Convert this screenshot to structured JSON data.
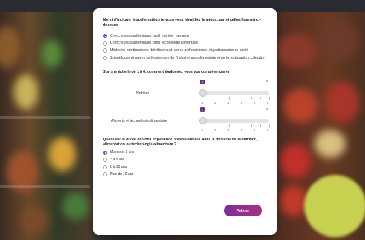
{
  "section1": {
    "question": "Merci d'indiquer à quelle catégorie vous vous identifiez le mieux, parmi celles figurant ci-dessous",
    "options": [
      {
        "label": "Chercheurs académiques, profil nutrition humaine",
        "selected": true
      },
      {
        "label": "Chercheurs académiques, profil technologie alimentaire",
        "selected": false
      },
      {
        "label": "Médecins nutritionnistes, diététiciens et autres professionnels et gestionnaires de santé",
        "selected": false
      },
      {
        "label": "Scientifiques et autres professionnels de l'industrie agroalimentaire et de la restauration collective",
        "selected": false
      }
    ]
  },
  "section2": {
    "question": "Sur une échelle de 1 à 6, comment évalueriez vous vos compétences en :",
    "sliders": [
      {
        "label": "Nutrition",
        "value": "1",
        "max": "6",
        "ticks": [
          "1",
          "2",
          "3",
          "4",
          "5",
          "6"
        ]
      },
      {
        "label": "Aliments et technologie alimentaire",
        "value": "1",
        "max": "6",
        "ticks": [
          "1",
          "2",
          "3",
          "4",
          "5",
          "6"
        ]
      }
    ]
  },
  "section3": {
    "question": "Quelle est la durée de votre expérience professionnelle dans le domaine de la nutrition, alimentation ou technologie alimentaire ?",
    "options": [
      {
        "label": "Moins de 2 ans",
        "selected": true
      },
      {
        "label": "2 à 5 ans",
        "selected": false
      },
      {
        "label": "5 à 10 ans",
        "selected": false
      },
      {
        "label": "Plus de 10 ans",
        "selected": false
      }
    ]
  },
  "submit_label": "Valider",
  "colors": {
    "accent_radio": "#3a66d6",
    "button_start": "#7a2f9a",
    "button_end": "#a8317d",
    "slider_badge": "#6b2d8c"
  }
}
